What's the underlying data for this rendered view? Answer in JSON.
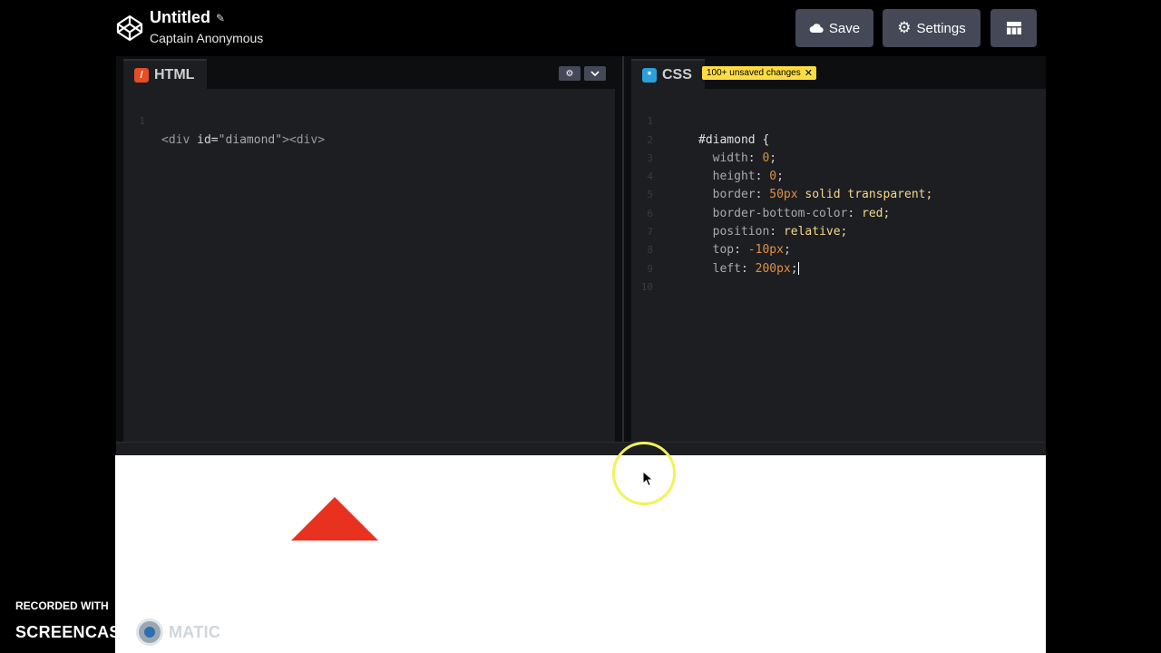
{
  "header": {
    "title": "Untitled",
    "author": "Captain Anonymous",
    "buttons": {
      "save": "Save",
      "settings": "Settings"
    }
  },
  "editors": {
    "html": {
      "tab_label": "HTML",
      "line_numbers": [
        "1"
      ],
      "code": {
        "open": "<div",
        "attr": " id=",
        "value": "\"diamond\"",
        "close": "><div>"
      }
    },
    "css": {
      "tab_label": "CSS",
      "badge": "100+ unsaved changes",
      "line_numbers": [
        "1",
        "2",
        "3",
        "4",
        "5",
        "6",
        "7",
        "8",
        "9",
        "10"
      ],
      "lines": [
        {
          "selector": "#diamond {"
        },
        {
          "prop": "width",
          "value": "0",
          "unit": ";"
        },
        {
          "prop": "height",
          "value": "0",
          "unit": ";"
        },
        {
          "prop": "border",
          "value": "50px",
          "rest": "solid transparent;"
        },
        {
          "prop": "border-bottom-color",
          "rest": "red;"
        },
        {
          "prop": "position",
          "rest": "relative;"
        },
        {
          "prop": "top",
          "value": "-10px",
          "unit": ";"
        },
        {
          "prop": "left",
          "value": "200px",
          "unit": ";"
        }
      ]
    }
  },
  "preview": {
    "shape_color": "#e8321f"
  },
  "watermark": {
    "line1": "RECORDED WITH",
    "brand_a": "SCREENCAST",
    "brand_b": "MATIC"
  },
  "icons": {
    "logo": "codepen-logo-icon",
    "edit": "pencil-icon",
    "save": "cloud-icon",
    "settings": "gear-icon",
    "layout": "layout-grid-icon",
    "html_tab": "html-icon",
    "css_tab": "css-icon",
    "editor_settings": "gear-icon",
    "collapse": "chevron-down-icon",
    "badge_close": "close-icon"
  }
}
